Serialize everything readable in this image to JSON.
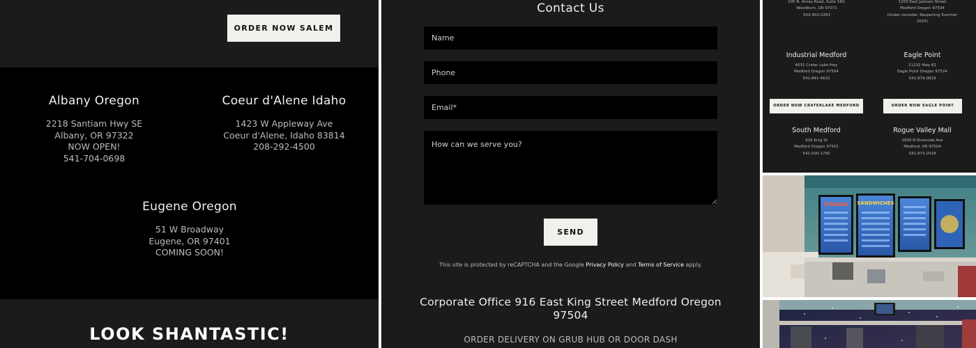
{
  "salem": {
    "button_label": "ORDER NOW SALEM"
  },
  "locations": [
    {
      "name": "Albany Oregon",
      "lines": [
        "2218 Santiam Hwy SE",
        "Albany, OR 97322",
        "NOW OPEN!",
        "541-704-0698"
      ]
    },
    {
      "name": "Coeur d'Alene Idaho",
      "lines": [
        "1423 W Appleway Ave",
        "Coeur d'Alene, Idaho 83814",
        "208-292-4500"
      ]
    },
    {
      "name": "Eugene Oregon",
      "lines": [
        "51 W Broadway",
        "Eugene, OR 97401",
        "COMING SOON!"
      ]
    }
  ],
  "slogan": "LOOK SHANTASTIC!",
  "contact": {
    "title": "Contact Us",
    "name_placeholder": "Name",
    "phone_placeholder": "Phone",
    "email_placeholder": "Email*",
    "message_placeholder": "How can we serve you?",
    "send_label": "SEND",
    "recaptcha_prefix": "This site is protected by reCAPTCHA and the Google",
    "privacy_link": "Privacy Policy",
    "and_text": "and",
    "terms_link": "Terms of Service",
    "apply_text": "apply."
  },
  "corporate": "Corporate Office 916 East King Street Medford Oregon 97504",
  "delivery": "ORDER DELIVERY ON GRUB HUB OR DOOR DASH",
  "right_locations": {
    "top_left": {
      "lines": [
        "105 N. Arney Road, Suite 160,",
        "Woodburn, OR 97071",
        "503-902-0263"
      ]
    },
    "top_right": {
      "lines": [
        "1203 East Jackson Street",
        "Medford Oregon 97504",
        "(Under remodel, Reopening Summer",
        "2024)"
      ]
    },
    "industrial": {
      "name": "Industrial Medford",
      "lines": [
        "4631 Crater Lake Hwy",
        "Medford Oregon 97504",
        "541-841-4632"
      ]
    },
    "eagle": {
      "name": "Eagle Point",
      "lines": [
        "11232 Hwy 62",
        "Eagle Point Oregon 97524",
        "541-879-0619"
      ]
    },
    "south": {
      "name": "South Medford",
      "lines": [
        "916 King St",
        "Medford Oregon 97501",
        "541-500-1700"
      ]
    },
    "rogue": {
      "name": "Rogue Valley Mall",
      "lines": [
        "1600 N Riverside Ave",
        "Medford, OR  97504",
        "541-973-2018"
      ]
    },
    "btn_crater": "ORDER NOW CRATERLAKE MEDFORD",
    "btn_eagle": "ORDER NOW EAGLE POINT"
  },
  "photos": {
    "menu_board_labels": [
      "TENDERS",
      "SANDWICHES"
    ]
  }
}
